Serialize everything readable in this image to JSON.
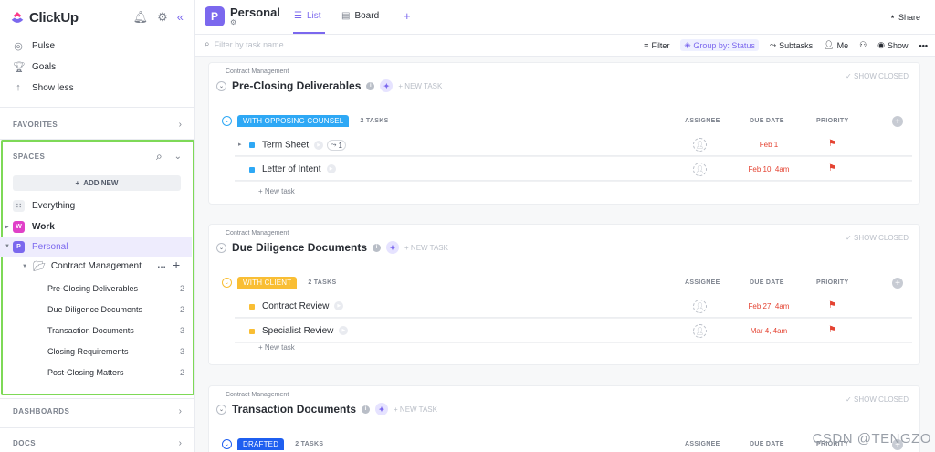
{
  "app": {
    "name": "ClickUp"
  },
  "sidebar": {
    "nav": [
      {
        "label": "Pulse",
        "icon": "pulse-icon"
      },
      {
        "label": "Goals",
        "icon": "trophy-icon"
      },
      {
        "label": "Show less",
        "icon": "arrow-up-icon"
      }
    ],
    "favorites_label": "FAVORITES",
    "spaces_label": "SPACES",
    "add_new_label": "ADD NEW",
    "everything_label": "Everything",
    "spaces": [
      {
        "initial": "W",
        "label": "Work",
        "color": "#e040c8"
      },
      {
        "initial": "P",
        "label": "Personal",
        "color": "#7b68ee"
      }
    ],
    "folder": {
      "label": "Contract Management"
    },
    "lists": [
      {
        "label": "Pre-Closing Deliverables",
        "count": "2"
      },
      {
        "label": "Due Diligence Documents",
        "count": "2"
      },
      {
        "label": "Transaction Documents",
        "count": "3"
      },
      {
        "label": "Closing Requirements",
        "count": "3"
      },
      {
        "label": "Post-Closing Matters",
        "count": "2"
      }
    ],
    "dashboards_label": "DASHBOARDS",
    "docs_label": "DOCS"
  },
  "header": {
    "badge": "P",
    "title": "Personal",
    "tabs": [
      {
        "label": "List"
      },
      {
        "label": "Board"
      }
    ],
    "plus": "+",
    "share_label": "Share"
  },
  "toolbar": {
    "search_placeholder": "Filter by task name...",
    "filter": "Filter",
    "group_by": "Group by: Status",
    "subtasks": "Subtasks",
    "me": "Me",
    "show": "Show"
  },
  "columns": {
    "assignee": "ASSIGNEE",
    "due_date": "DUE DATE",
    "priority": "PRIORITY"
  },
  "common": {
    "new_task": "+ NEW TASK",
    "show_closed": "SHOW CLOSED",
    "add_task": "+ New task",
    "crumb": "Contract Management"
  },
  "lists": [
    {
      "title": "Pre-Closing Deliverables",
      "status": {
        "label": "WITH OPPOSING COUNSEL",
        "color": "#2ea8f5"
      },
      "count": "2 TASKS",
      "tasks": [
        {
          "name": "Term Sheet",
          "subtasks": "1",
          "due": "Feb 1",
          "dot": "#2ea8f5"
        },
        {
          "name": "Letter of Intent",
          "due": "Feb 10, 4am",
          "dot": "#2ea8f5"
        }
      ]
    },
    {
      "title": "Due Diligence Documents",
      "status": {
        "label": "WITH CLIENT",
        "color": "#f9be34"
      },
      "count": "2 TASKS",
      "tasks": [
        {
          "name": "Contract Review",
          "due": "Feb 27, 4am",
          "dot": "#f9be34"
        },
        {
          "name": "Specialist Review",
          "due": "Mar 4, 4am",
          "dot": "#f9be34"
        }
      ]
    },
    {
      "title": "Transaction Documents",
      "status": {
        "label": "DRAFTED",
        "color": "#1f5ff0"
      },
      "count": "2 TASKS",
      "tasks": []
    }
  ],
  "watermark": "CSDN @TENGZO"
}
